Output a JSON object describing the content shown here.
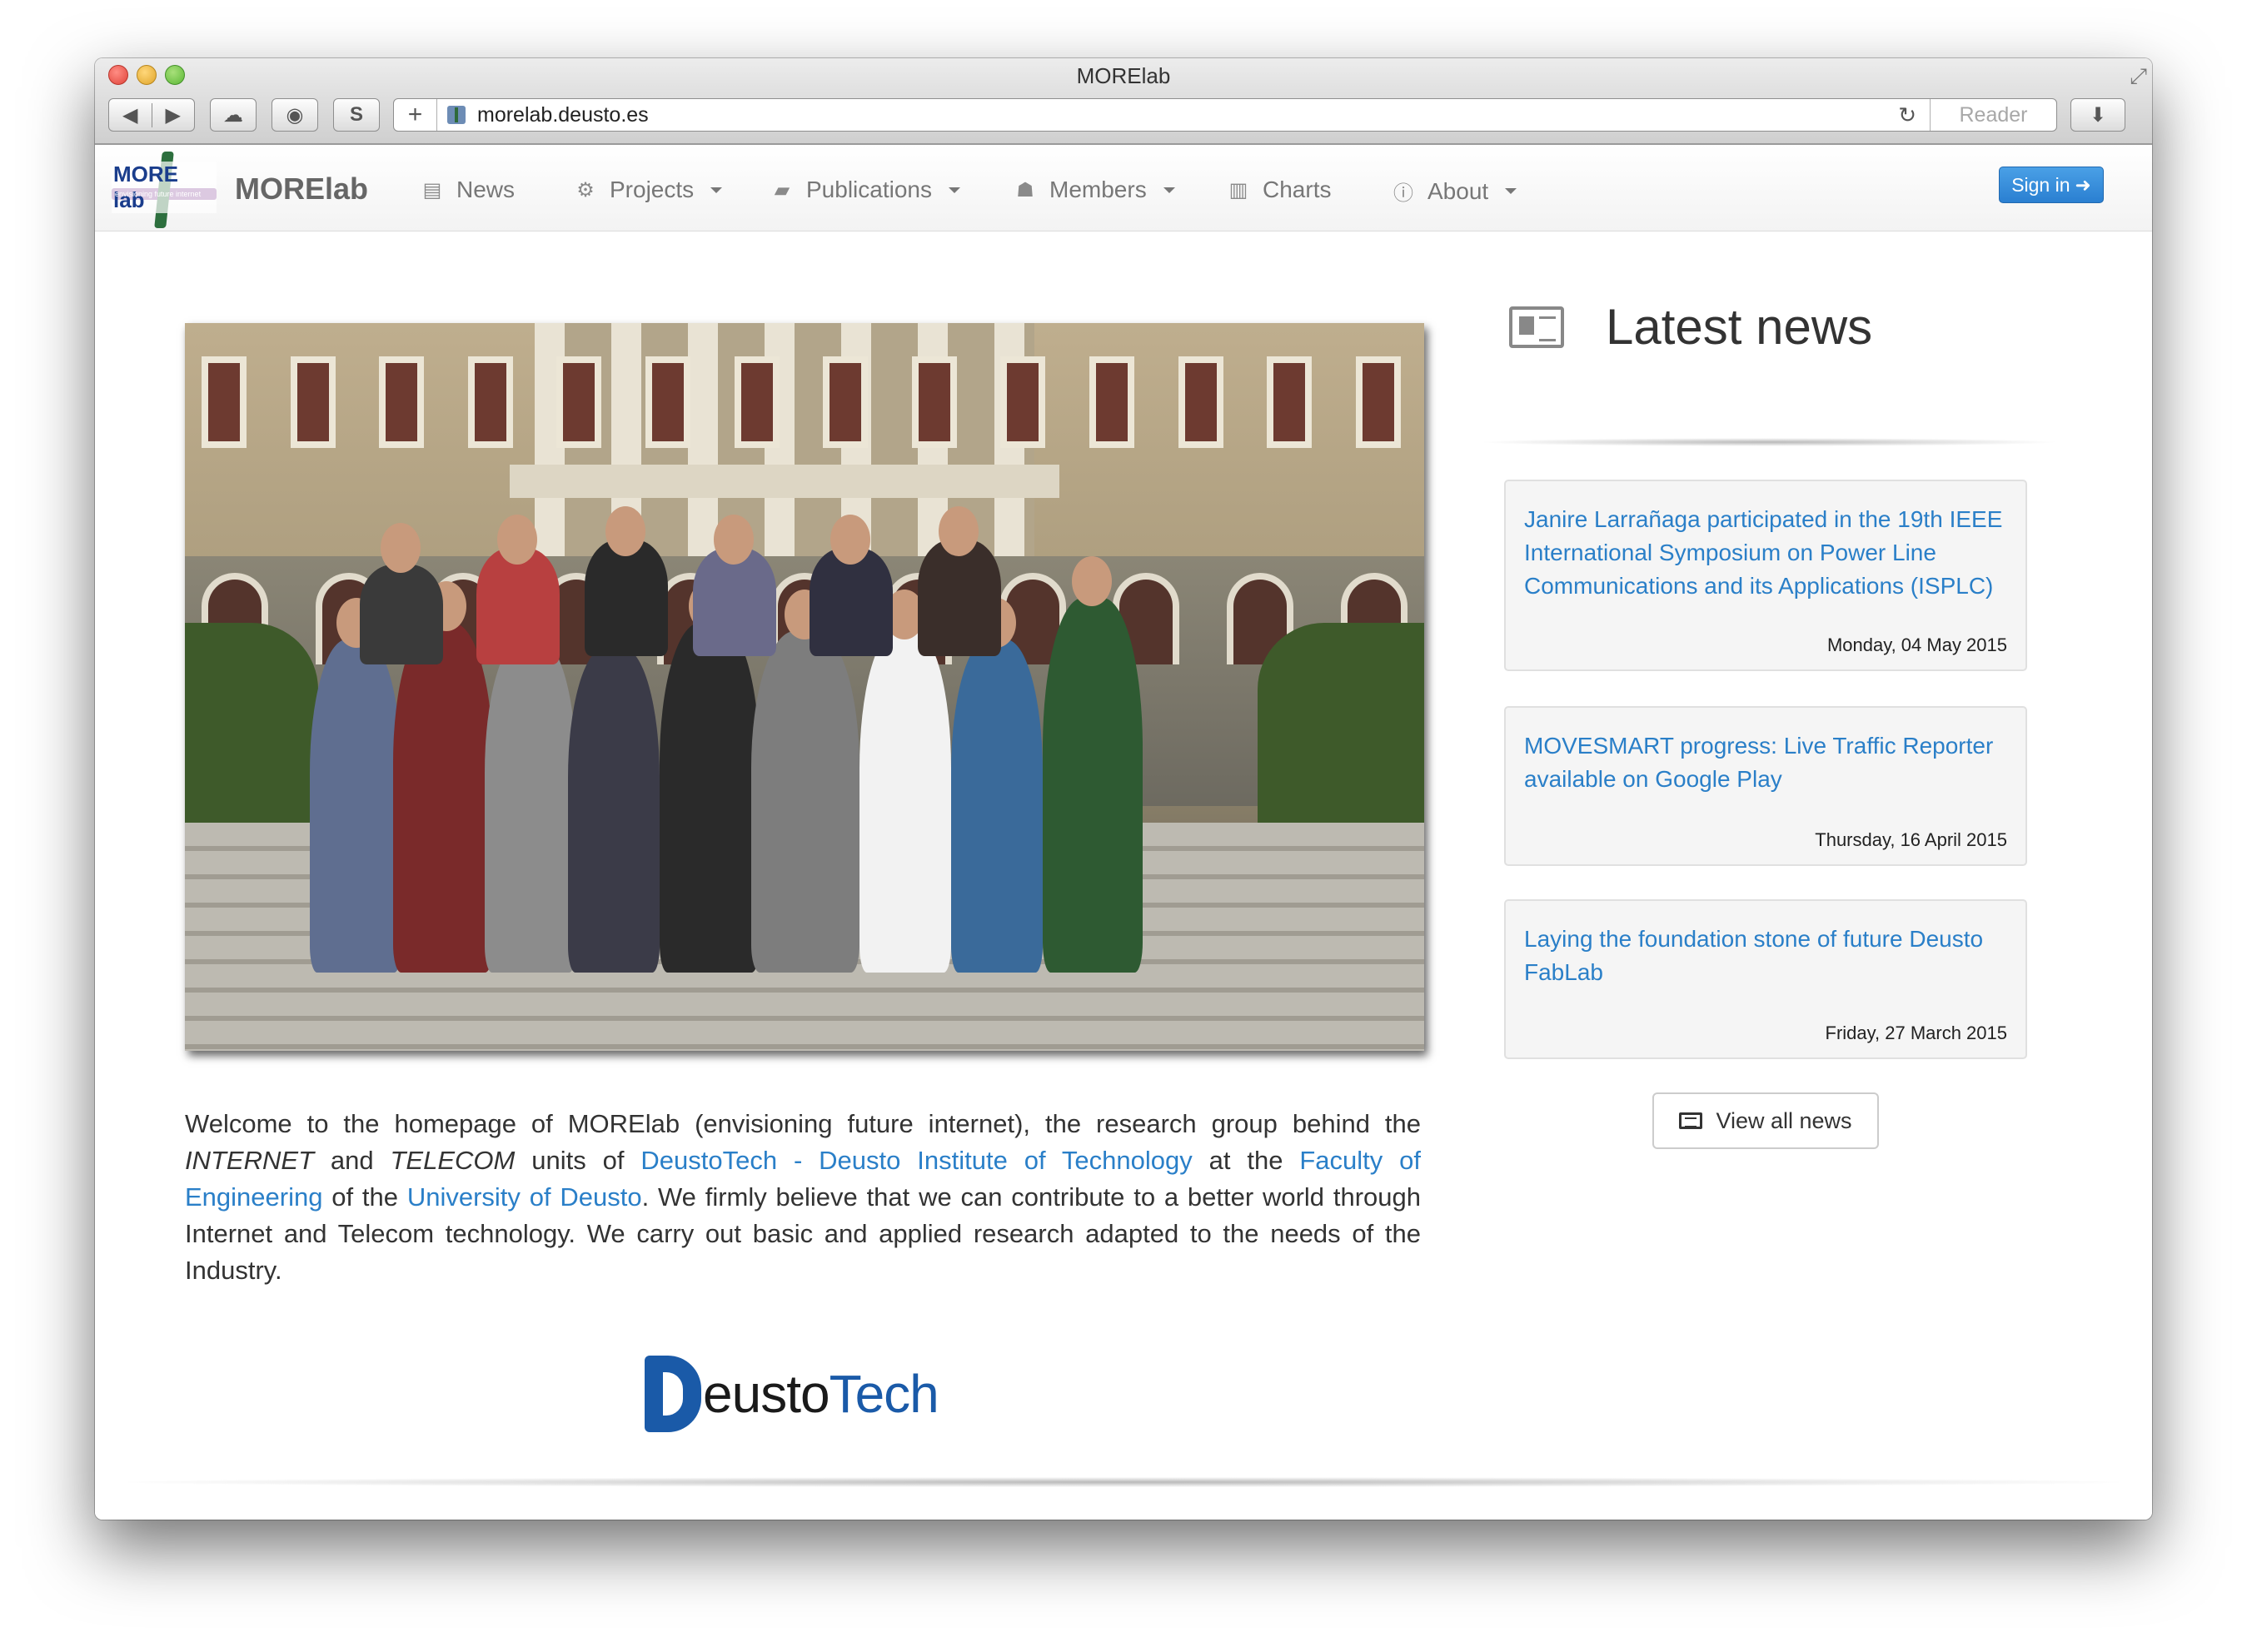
{
  "window": {
    "title": "MORElab",
    "url": "morelab.deusto.es",
    "reader_label": "Reader",
    "s_label": "S"
  },
  "navbar": {
    "logo_text": "MORE lab",
    "logo_tagline": "envisioning future internet",
    "brand": "MORElab",
    "items": [
      {
        "label": "News",
        "icon": "newspaper-icon",
        "dropdown": false
      },
      {
        "label": "Projects",
        "icon": "cogs-icon",
        "dropdown": true
      },
      {
        "label": "Publications",
        "icon": "book-icon",
        "dropdown": true
      },
      {
        "label": "Members",
        "icon": "group-icon",
        "dropdown": true
      },
      {
        "label": "Charts",
        "icon": "bar-chart-icon",
        "dropdown": false
      },
      {
        "label": "About",
        "icon": "info-icon",
        "dropdown": true
      }
    ],
    "signin_label": "Sign in"
  },
  "intro": {
    "p1": "Welcome to the homepage of MORElab (envisioning future internet), the research group behind the ",
    "internet": "INTERNET",
    "and": " and ",
    "telecom": "TELECOM",
    "units_of": " units of ",
    "link1": "DeustoTech - Deusto Institute of Technology",
    "at_the": " at the ",
    "link2": "Faculty of Engineering",
    "of_the": " of the ",
    "link3": "University of Deusto",
    "p2": ". We firmly believe that we can contribute to a better world through Internet and Telecom technology. We carry out basic and applied research adapted to the needs of the Industry."
  },
  "deusto_logo": {
    "d": "D",
    "eusto": "eusto",
    "tech": "Tech"
  },
  "news": {
    "title": "Latest news",
    "items": [
      {
        "headline": "Janire Larrañaga participated in the 19th IEEE International Symposium on Power Line Communications and its Applications (ISPLC)",
        "date": "Monday, 04 May 2015"
      },
      {
        "headline": "MOVESMART progress: Live Traffic Reporter available on Google Play",
        "date": "Thursday, 16 April 2015"
      },
      {
        "headline": "Laying the foundation stone of future Deusto FabLab",
        "date": "Friday, 27 March 2015"
      }
    ],
    "view_all_label": "View all news"
  }
}
